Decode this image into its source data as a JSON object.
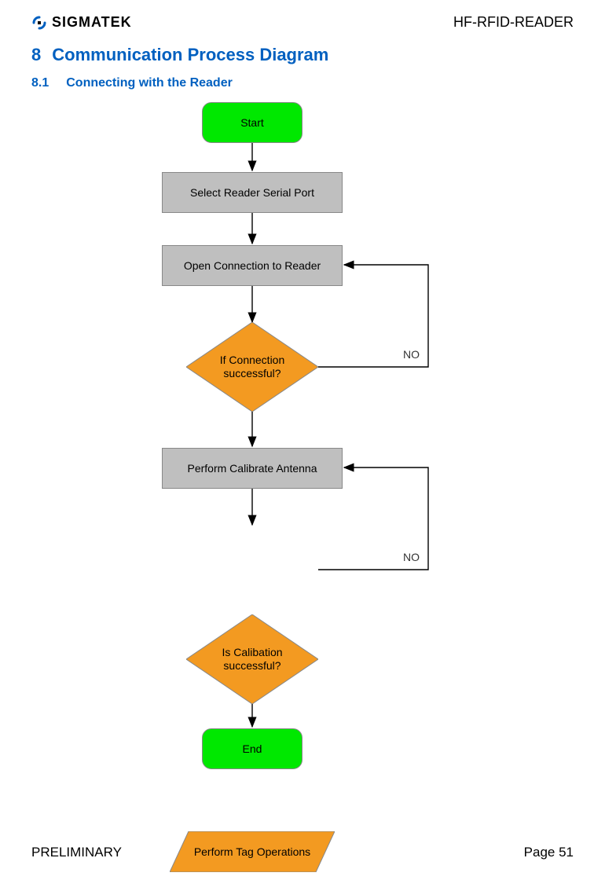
{
  "header": {
    "logo_text": "SIGMATEK",
    "doc_title": "HF-RFID-READER"
  },
  "headings": {
    "h1_num": "8",
    "h1_text": "Communication Process Diagram",
    "h2_num": "8.1",
    "h2_text": "Connecting with the Reader"
  },
  "flow": {
    "start": "Start",
    "select_port": "Select Reader Serial Port",
    "open_conn": "Open Connection to Reader",
    "conn_q": "If Connection successful?",
    "calibrate": "Perform Calibrate Antenna",
    "calib_q": "Is Calibation successful?",
    "tag_ops": "Perform Tag Operations",
    "end": "End",
    "no1": "NO",
    "no2": "NO"
  },
  "footer": {
    "left": "PRELIMINARY",
    "right": "Page 51"
  },
  "colors": {
    "heading_blue": "#0060c0",
    "terminator_green": "#00e800",
    "process_gray": "#bfbfbf",
    "decision_orange": "#f39a21",
    "io_orange": "#f39a21"
  },
  "chart_data": {
    "type": "flowchart",
    "nodes": [
      {
        "id": "start",
        "kind": "terminator",
        "label": "Start"
      },
      {
        "id": "select_port",
        "kind": "process",
        "label": "Select Reader Serial Port"
      },
      {
        "id": "open_conn",
        "kind": "process",
        "label": "Open Connection to Reader"
      },
      {
        "id": "conn_q",
        "kind": "decision",
        "label": "If Connection successful?"
      },
      {
        "id": "calibrate",
        "kind": "process",
        "label": "Perform Calibrate Antenna"
      },
      {
        "id": "calib_q",
        "kind": "decision",
        "label": "Is Calibation successful?"
      },
      {
        "id": "tag_ops",
        "kind": "io",
        "label": "Perform Tag Operations"
      },
      {
        "id": "end",
        "kind": "terminator",
        "label": "End"
      }
    ],
    "edges": [
      {
        "from": "start",
        "to": "select_port"
      },
      {
        "from": "select_port",
        "to": "open_conn"
      },
      {
        "from": "open_conn",
        "to": "conn_q"
      },
      {
        "from": "conn_q",
        "to": "calibrate",
        "label": ""
      },
      {
        "from": "conn_q",
        "to": "open_conn",
        "label": "NO"
      },
      {
        "from": "calibrate",
        "to": "calib_q"
      },
      {
        "from": "calib_q",
        "to": "tag_ops",
        "label": ""
      },
      {
        "from": "calib_q",
        "to": "calibrate",
        "label": "NO"
      },
      {
        "from": "tag_ops",
        "to": "end"
      }
    ]
  }
}
